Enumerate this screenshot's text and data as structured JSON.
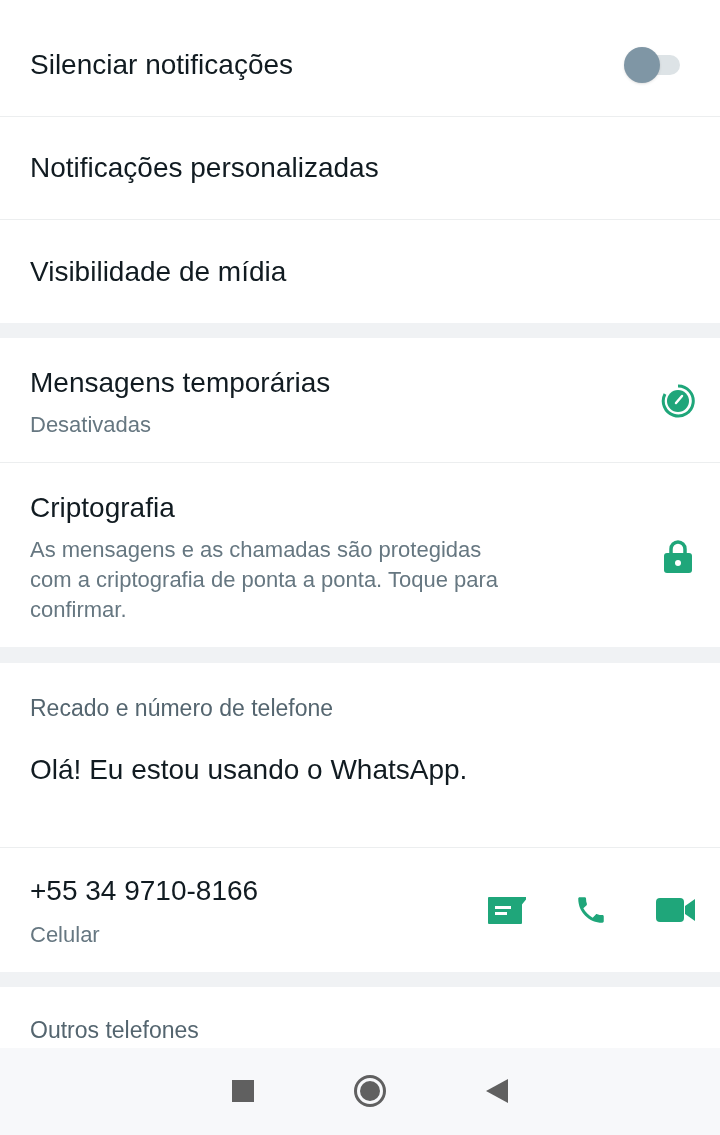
{
  "settings": [
    {
      "label": "Silenciar notificações",
      "kind": "toggle",
      "on": false
    },
    {
      "label": "Notificações personalizadas",
      "kind": "plain"
    },
    {
      "label": "Visibilidade de mídia",
      "kind": "plain"
    }
  ],
  "privacy": [
    {
      "title": "Mensagens temporárias",
      "subtitle": "Desativadas",
      "kind": "timer"
    },
    {
      "title": "Criptografia",
      "subtitle": "As mensagens e as chamadas são protegidas com a criptografia de ponta a ponta. Toque para confirmar.",
      "kind": "lock"
    }
  ],
  "about": {
    "heading": "Recado e número de telefone",
    "status": "Olá! Eu estou usando o WhatsApp.",
    "phone": "+55 34 9710-8166",
    "phone_type": "Celular"
  },
  "other_phones": {
    "heading": "Outros telefones"
  }
}
